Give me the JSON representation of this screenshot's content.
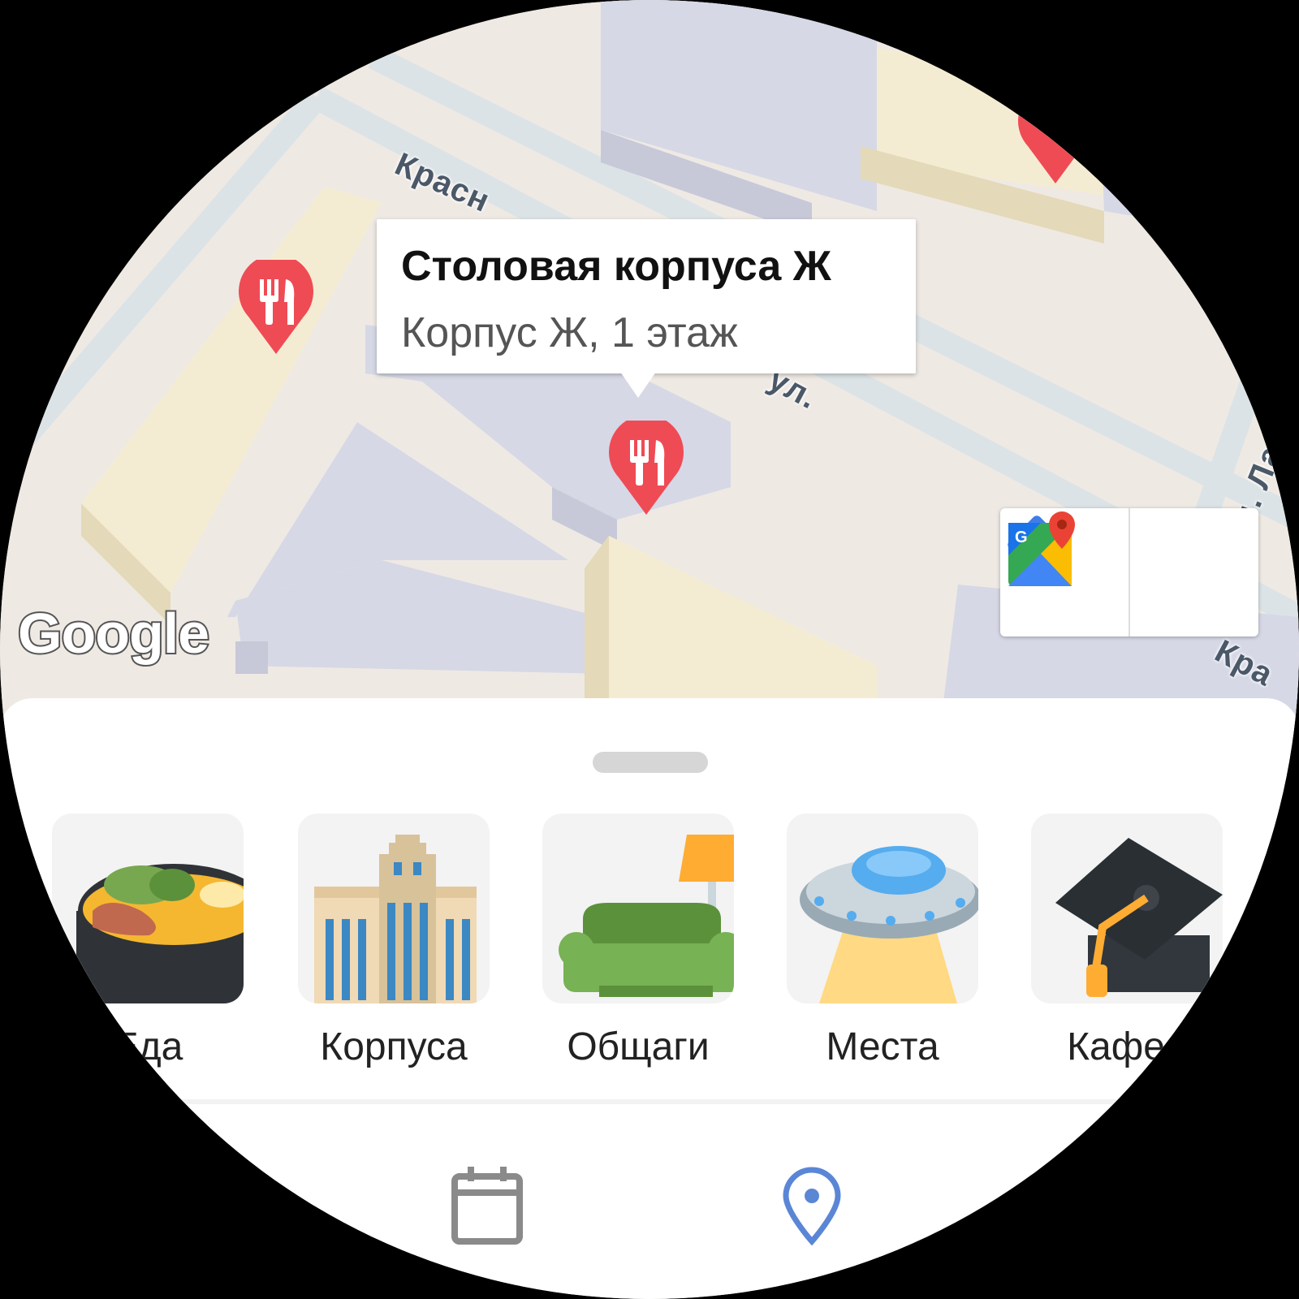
{
  "map": {
    "streets": [
      "Красн",
      "ул.",
      "ул. Ла",
      "Кра"
    ],
    "callout": {
      "title": "Столовая корпуса Ж",
      "subtitle": "Корпус Ж, 1 этаж"
    },
    "attribution": "Google",
    "buttons": [
      {
        "icon": "directions-icon"
      },
      {
        "icon": "google-maps-icon"
      }
    ],
    "pins": [
      {
        "icon": "restaurant-pin-icon",
        "color": "#ef4b55"
      }
    ]
  },
  "categories": [
    {
      "label": "Еда",
      "icon": "food-pot-icon"
    },
    {
      "label": "Корпуса",
      "icon": "office-building-icon"
    },
    {
      "label": "Общаги",
      "icon": "couch-lamp-icon"
    },
    {
      "label": "Места",
      "icon": "ufo-icon"
    },
    {
      "label": "Кафед",
      "icon": "graduation-cap-icon"
    }
  ],
  "bottom_nav": [
    {
      "icon": "calendar-icon",
      "active": false
    },
    {
      "icon": "location-pin-icon",
      "active": true
    }
  ],
  "colors": {
    "pin": "#ef4b55",
    "accent": "#5b86d6",
    "inactive": "#8a8a8a"
  }
}
